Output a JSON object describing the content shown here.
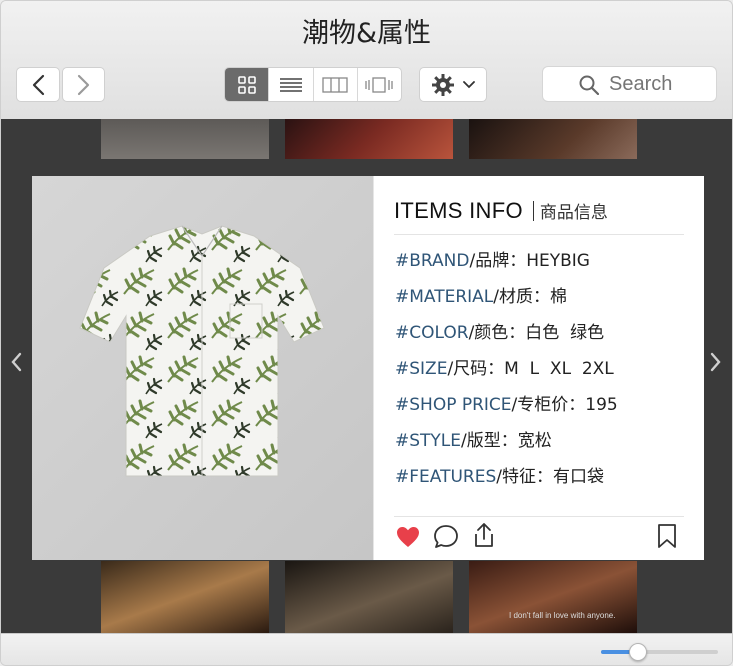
{
  "window": {
    "title": "潮物&属性"
  },
  "toolbar": {
    "view_modes": [
      "grid-view-icon",
      "list-view-icon",
      "column-view-icon",
      "gallery-view-icon"
    ],
    "active_view": 0,
    "search": {
      "placeholder": "Search"
    }
  },
  "card": {
    "title": "ITEMS INFO",
    "subtitle": "商品信息",
    "rows": [
      {
        "key": "#BRAND",
        "value": "/品牌：HEYBIG"
      },
      {
        "key": "#MATERIAL",
        "value": "/材质：棉"
      },
      {
        "key": "#COLOR",
        "value": "/颜色：白色  绿色"
      },
      {
        "key": "#SIZE",
        "value": "/尺码：M  L  XL  2XL"
      },
      {
        "key": "#SHOP PRICE",
        "value": "/专柜价：195"
      },
      {
        "key": "#STYLE",
        "value": "/版型：宽松"
      },
      {
        "key": "#FEATURES",
        "value": "/特征：有口袋"
      }
    ],
    "actions": [
      "heart-icon",
      "comment-icon",
      "share-icon",
      "bookmark-icon"
    ],
    "liked": true
  },
  "thumbnail_caption": "I don't fall in love with anyone.",
  "zoom": {
    "level": 0.31
  },
  "colors": {
    "accent": "#4a90e2",
    "heart": "#e8404a",
    "key": "#2f5577",
    "active_segment": "#6b6b6b"
  }
}
